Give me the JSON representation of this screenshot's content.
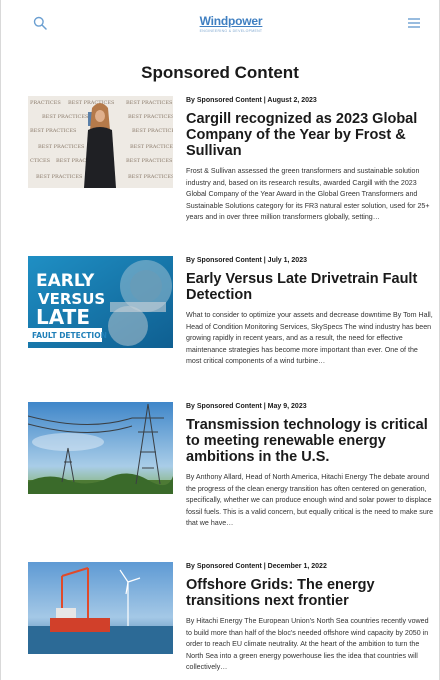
{
  "header": {
    "logo_text": "Windpower",
    "logo_sub": "ENGINEERING & DEVELOPMENT",
    "search_icon": "search-icon",
    "menu_icon": "menu-icon",
    "accent": "#3f7fc1"
  },
  "page_title": "Sponsored Content",
  "articles": [
    {
      "byline": "By Sponsored Content | August 2, 2023",
      "title": "Cargill recognized as 2023 Global Company of the Year by Frost & Sullivan",
      "excerpt": "Frost & Sullivan assessed the green transformers and sustainable solution industry and, based on its research results, awarded Cargill with the 2023 Global Company of the Year Award in the Global Green Transformers and Sustainable Solutions category for its FR3 natural ester solution, used for 25+ years and in over three million transformers globally, setting…"
    },
    {
      "byline": "By Sponsored Content | July 1, 2023",
      "title": "Early Versus Late Drivetrain Fault Detection",
      "excerpt": "What to consider to optimize your assets and decrease downtime By Tom Hall, Head of Condition Monitoring Services, SkySpecs The wind industry has been growing rapidly in recent years, and as a result, the need for effective maintenance strategies has become more important than ever. One of the most critical components of a wind turbine…",
      "image_text": {
        "line1": "EARLY",
        "line2": "VERSUS",
        "line3": "LATE",
        "banner": "FAULT DETECTION"
      }
    },
    {
      "byline": "By Sponsored Content | May 9, 2023",
      "title": "Transmission technology is critical to meeting renewable energy ambitions in the U.S.",
      "excerpt": "By Anthony Allard, Head of North America, Hitachi Energy The debate around the progress of the clean energy transition has often centered on generation, specifically, whether we can produce enough wind and solar power to displace fossil fuels. This is a valid concern, but equally critical is the need to make sure that we have…"
    },
    {
      "byline": "By Sponsored Content | December 1, 2022",
      "title": "Offshore Grids: The energy transitions next frontier",
      "excerpt": "By Hitachi Energy The European Union's North Sea countries recently vowed to build more than half of the bloc's needed offshore wind capacity by 2050 in order to reach EU climate neutrality. At the heart of the ambition to turn the North Sea into a green energy powerhouse lies the idea that countries will collectively…"
    }
  ]
}
